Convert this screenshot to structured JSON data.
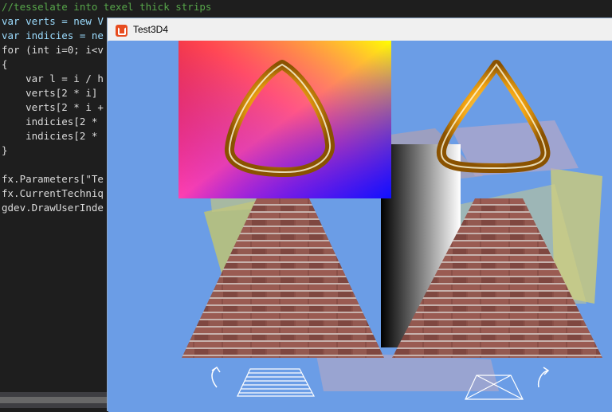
{
  "editor": {
    "lines": [
      {
        "text": "//tesselate into texel thick strips",
        "color": "#57a64a"
      },
      {
        "text": "var verts = new V",
        "color": "#9cdcfe"
      },
      {
        "text": "var indicies = ne",
        "color": "#9cdcfe"
      },
      {
        "text": "for (int i=0; i<v",
        "color": "#dcdcdc"
      },
      {
        "text": "{",
        "color": "#dcdcdc"
      },
      {
        "text": "    var l = i / h",
        "color": "#dcdcdc"
      },
      {
        "text": "    verts[2 * i]",
        "color": "#dcdcdc"
      },
      {
        "text": "    verts[2 * i +",
        "color": "#dcdcdc"
      },
      {
        "text": "    indicies[2 *",
        "color": "#dcdcdc"
      },
      {
        "text": "    indicies[2 *",
        "color": "#dcdcdc"
      },
      {
        "text": "}",
        "color": "#dcdcdc"
      },
      {
        "text": "",
        "color": "#dcdcdc"
      },
      {
        "text": "fx.Parameters[\"Te",
        "color": "#dcdcdc"
      },
      {
        "text": "fx.CurrentTechniq",
        "color": "#dcdcdc"
      },
      {
        "text": "gdev.DrawUserInde",
        "color": "#dcdcdc"
      }
    ]
  },
  "window": {
    "title": "Test3D4",
    "icon": "monogame-app-icon"
  },
  "colors": {
    "viewport_background": "#6b9de6",
    "editor_background": "#1e1e1e",
    "brick": "#8a4f47",
    "ring_gold": "#f2a311"
  }
}
